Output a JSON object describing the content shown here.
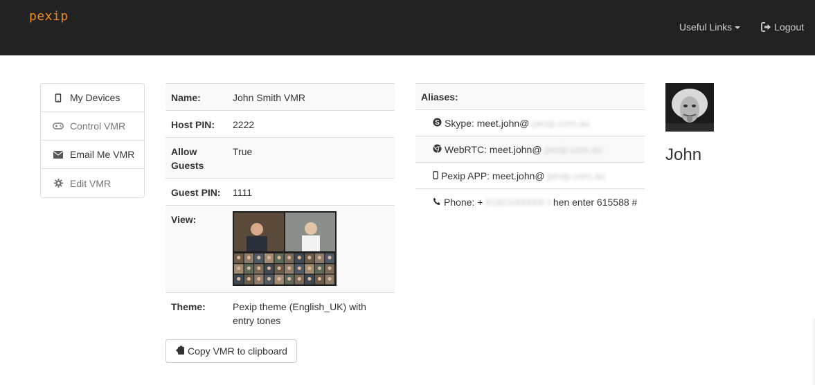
{
  "navbar": {
    "logo": "pexip",
    "useful_links": "Useful Links",
    "logout": "Logout"
  },
  "sidebar": {
    "items": [
      {
        "label": "My Devices",
        "icon": "mobile-icon"
      },
      {
        "label": "Control VMR",
        "icon": "gamepad-icon"
      },
      {
        "label": "Email Me VMR",
        "icon": "envelope-icon"
      },
      {
        "label": "Edit VMR",
        "icon": "gear-icon"
      }
    ]
  },
  "details": {
    "rows": [
      {
        "key": "Name:",
        "value": "John Smith VMR"
      },
      {
        "key": "Host PIN:",
        "value": "2222"
      },
      {
        "key": "Allow Guests",
        "value": "True"
      },
      {
        "key": "Guest PIN:",
        "value": "1111"
      },
      {
        "key": "View:",
        "value": ""
      },
      {
        "key": "Theme:",
        "value": "Pexip theme (English_UK) with entry tones"
      }
    ]
  },
  "copy_button": {
    "label": "Copy VMR to clipboard"
  },
  "aliases": {
    "header": "Aliases:",
    "items": [
      {
        "icon": "skype-icon",
        "prefix": "Skype: meet.john@",
        "hidden": "pexip.com.au",
        "suffix": ""
      },
      {
        "icon": "chrome-icon",
        "prefix": "WebRTC: meet.john@",
        "hidden": "pexip.com.au",
        "suffix": ""
      },
      {
        "icon": "mobile-icon",
        "prefix": "Pexip APP: meet.john@",
        "hidden": "pexip.com.au",
        "suffix": ""
      },
      {
        "icon": "phone-icon",
        "prefix": "Phone: +",
        "hidden": "61821000000 t",
        "suffix": "hen enter 615588 #"
      }
    ]
  },
  "profile": {
    "name": "John"
  },
  "colors": {
    "navbar": "#222222",
    "logo": "#f08a24",
    "border": "#dddddd",
    "stripe": "#f9f9f9"
  }
}
